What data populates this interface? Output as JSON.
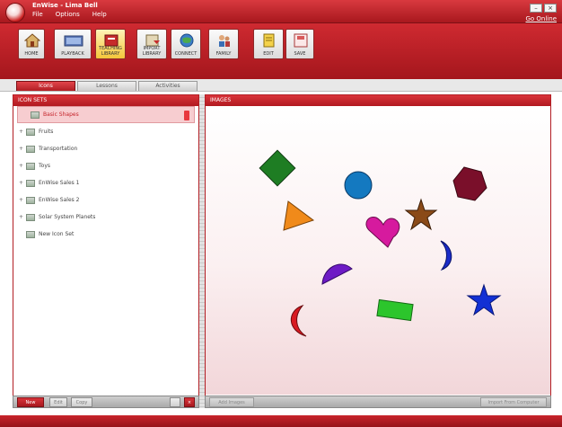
{
  "window": {
    "title": "EnWise - Lima Bell"
  },
  "menu": [
    "File",
    "Options",
    "Help"
  ],
  "top_right_link": "Go Online",
  "toolbar": [
    {
      "label": "Home",
      "icon": "house-icon"
    },
    {
      "label": "Playback",
      "icon": "playback-icon"
    },
    {
      "label": "Teaching Library",
      "icon": "library-icon",
      "active": true
    },
    {
      "label": "Import Library",
      "icon": "import-icon"
    },
    {
      "label": "Connect",
      "icon": "globe-icon"
    },
    {
      "label": "Family",
      "icon": "family-icon"
    },
    {
      "label": "Edit",
      "icon": "edit-icon"
    },
    {
      "label": "Save",
      "icon": "save-icon"
    }
  ],
  "tabs": [
    "Icons",
    "Lessons",
    "Activities"
  ],
  "left_panel": {
    "header": "ICON SETS",
    "items": [
      {
        "label": "Basic Shapes",
        "expandable": false,
        "selected": true
      },
      {
        "label": "Fruits",
        "expandable": true
      },
      {
        "label": "Transportation",
        "expandable": true
      },
      {
        "label": "Toys",
        "expandable": true
      },
      {
        "label": "EnWise Sales 1",
        "expandable": true
      },
      {
        "label": "EnWise Sales 2",
        "expandable": true
      },
      {
        "label": "Solar System Planets",
        "expandable": true
      },
      {
        "label": "New Icon Set",
        "expandable": false
      }
    ],
    "footer": {
      "new_label": "New",
      "btn2": "Edit",
      "btn3": "Copy"
    }
  },
  "right_panel": {
    "header": "IMAGES",
    "footer": {
      "left_btn": "Add Images",
      "right_btn": "Import From Computer"
    }
  },
  "shapes": [
    {
      "name": "green-diamond-shape",
      "color": "#1e7d23"
    },
    {
      "name": "blue-circle-shape",
      "color": "#1479c0"
    },
    {
      "name": "maroon-hexagon-shape",
      "color": "#7a0f2a"
    },
    {
      "name": "orange-triangle-shape",
      "color": "#f08a1a"
    },
    {
      "name": "brown-star-shape",
      "color": "#8a4a18"
    },
    {
      "name": "magenta-heart-shape",
      "color": "#d61a9e"
    },
    {
      "name": "blue-crescent-shape",
      "color": "#1a2bc8"
    },
    {
      "name": "purple-semicircle-shape",
      "color": "#6d1bc5"
    },
    {
      "name": "blue-star-shape",
      "color": "#1230d4"
    },
    {
      "name": "red-crescent-shape",
      "color": "#d81b22"
    },
    {
      "name": "green-rectangle-shape",
      "color": "#2cc52c"
    }
  ]
}
